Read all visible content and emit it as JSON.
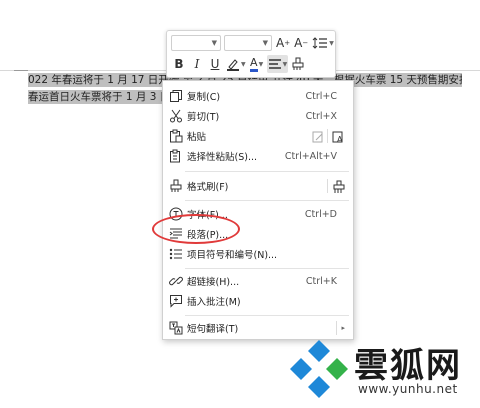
{
  "document": {
    "line1": "022 年春运将于 1 月 17 日开始,至 2 月 25 日结束,共计 40 天。根据火车票 15 天预售期安排,2022 年",
    "line2": "春运首日火车票将于 1 月 3 日开"
  },
  "toolbar": {
    "bold": "B",
    "italic": "I",
    "underline": "U",
    "font_color": "A",
    "grow_font": "A",
    "shrink_font": "A"
  },
  "menu": {
    "items": [
      {
        "label": "复制(C)",
        "shortcut": "Ctrl+C"
      },
      {
        "label": "剪切(T)",
        "shortcut": "Ctrl+X"
      },
      {
        "label": "粘贴",
        "shortcut": ""
      },
      {
        "label": "选择性粘贴(S)...",
        "shortcut": "Ctrl+Alt+V"
      },
      {
        "label": "格式刷(F)",
        "shortcut": ""
      },
      {
        "label": "字体(F)...",
        "shortcut": "Ctrl+D"
      },
      {
        "label": "段落(P)...",
        "shortcut": ""
      },
      {
        "label": "项目符号和编号(N)...",
        "shortcut": ""
      },
      {
        "label": "超链接(H)...",
        "shortcut": "Ctrl+K"
      },
      {
        "label": "插入批注(M)",
        "shortcut": ""
      },
      {
        "label": "短句翻译(T)",
        "shortcut": ""
      }
    ]
  },
  "watermark": {
    "name": "雲狐网",
    "url": "www.yunhu.net"
  },
  "colors": {
    "annotation": "#e03a3a",
    "font_color_underline": "#2b57c9",
    "logo_blue": "#1e88d8",
    "logo_green": "#34b24a"
  }
}
